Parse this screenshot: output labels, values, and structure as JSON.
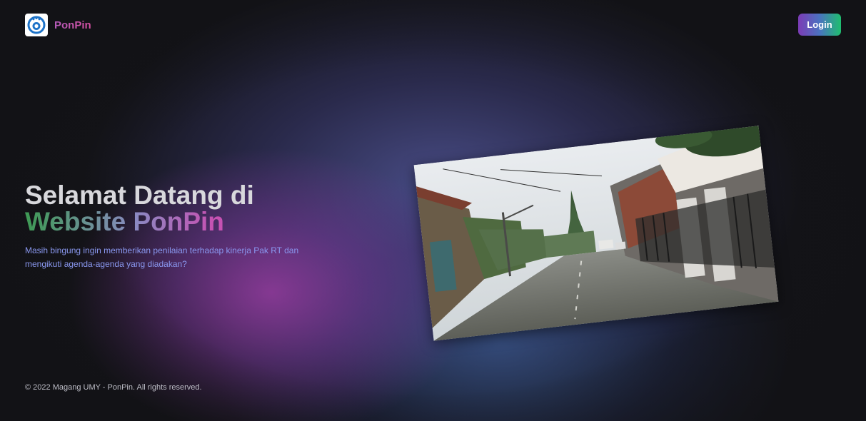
{
  "navbar": {
    "brand_name": "PonPin",
    "login_label": "Login"
  },
  "hero": {
    "title_line1": "Selamat Datang di",
    "title_line2": "Website PonPin",
    "description": "Masih bingung ingin memberikan penilaian terhadap kinerja Pak RT dan mengikuti agenda-agenda yang diadakan?"
  },
  "hero_image": {
    "subject": "residential street photo"
  },
  "footer": {
    "copyright": "© 2022 Magang UMY - PonPin. All rights reserved."
  },
  "colors": {
    "background": "#131317",
    "brand_pink": "#c84fae",
    "description_blue": "#8a98f0",
    "login_gradient_start": "#7c3bb6",
    "login_gradient_end": "#1fbe6f"
  },
  "icons": {
    "logo": "ponpin-logo-icon"
  }
}
